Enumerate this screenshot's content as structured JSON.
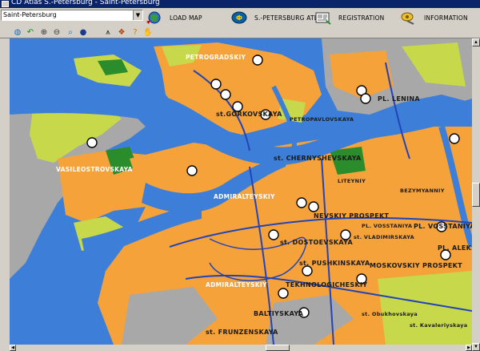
{
  "window": {
    "title": "CD Atlas S.-Petersburg - Saint-Petersburg"
  },
  "city_select": {
    "value": "Saint-Petersburg"
  },
  "nav": {
    "load_map": "LOAD MAP",
    "atlas": "S.-PETERSBURG ATLAS",
    "registration": "REGISTRATION",
    "information": "INFORMATION"
  },
  "toolbar": {
    "tools": [
      "globe-icon",
      "undo-icon",
      "zoom-in-icon",
      "zoom-out-icon",
      "magnifier-icon",
      "sphere-icon",
      "compass-icon",
      "layers-icon",
      "help-icon",
      "hand-icon"
    ]
  },
  "map": {
    "colors": {
      "water": "#3d7fd8",
      "block": "#f5a23a",
      "green": "#c7d84a",
      "industrial": "#a8a8a8",
      "park": "#2a8c2a",
      "road": "#2244b8"
    },
    "labels": {
      "petrogradsky": "PETROGRADSKIY",
      "kronverk": "st.GORKOVSKAYA",
      "petropavlovsk": "PETROPAVLOVSKAYA",
      "lenina": "PL. LENINA",
      "vasileostrovsky": "VASILEOSTROVSKAYA",
      "chernyshevskaya": "st. CHERNYSHEVSKAYA",
      "admiraltejsky": "ADMIRALTEYSKIY",
      "nevsky": "NEVSKIY PROSPEKT",
      "gostiny": "st. DOSTOEVSKAYA",
      "vladimirskaya": "st. VLADIMIRSKAYA",
      "pushkinskaya": "st. PUSHKINSKAYA",
      "tekhnologichesky": "TEKHNOLOGICHESKIY",
      "admiraltejsky2": "ADMIRALTEYSKIY",
      "frunzenskaya": "st. FRUNZENSKAYA",
      "baltiyskaya": "BALTIYSKAYA",
      "smolny": "PL. ALEKS",
      "ploschad": "PL. VOSSTANIYA",
      "moskovsky": "MOSKOVSKIY PROSPEKT",
      "bezymyanny": "BEZYMYANNIY",
      "pl_vosstaniya": "PL. VOSSTANIYA",
      "obukhovskaya": "st. Obukhovskaya",
      "kavalerijskaya": "st. Kavaleriyskaya",
      "liteyny": "LITEYNIY"
    }
  }
}
